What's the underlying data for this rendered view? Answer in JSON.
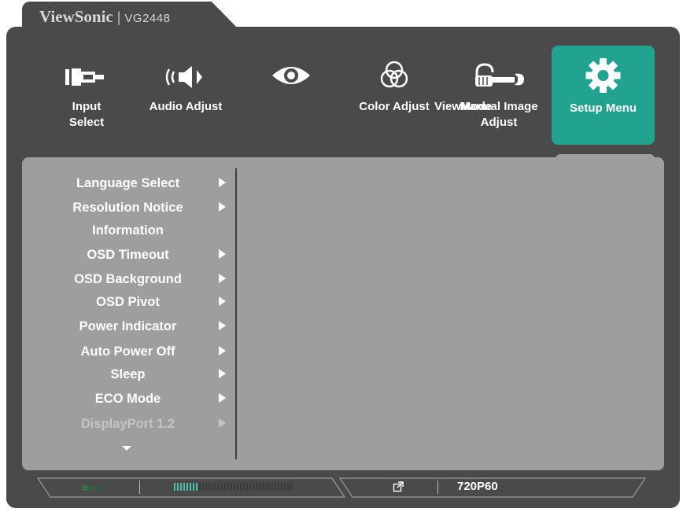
{
  "brand": {
    "logo": "ViewSonic",
    "separator": "|",
    "model": "VG2448"
  },
  "top_menu": [
    {
      "label": "Input\nSelect",
      "icon": "input-select-icon"
    },
    {
      "label": "Audio Adjust",
      "icon": "speaker-icon"
    },
    {
      "label": "",
      "icon": "eye-icon"
    },
    {
      "label": "Color Adjust",
      "icon": "color-circles-icon"
    },
    {
      "label": "ViewMode",
      "icon": "hand-wrench-icon"
    },
    {
      "label": "Manual Image\nAdjust",
      "icon": "hand-wrench-icon"
    },
    {
      "label": "Setup Menu",
      "icon": "gear-icon",
      "selected": true
    }
  ],
  "submenu": [
    {
      "label": "Language Select",
      "arrow": true
    },
    {
      "label": "Resolution Notice",
      "arrow": true
    },
    {
      "label": "Information",
      "arrow": false
    },
    {
      "label": "OSD Timeout",
      "arrow": true
    },
    {
      "label": "OSD Background",
      "arrow": true
    },
    {
      "label": "OSD Pivot",
      "arrow": true
    },
    {
      "label": "Power Indicator",
      "arrow": true
    },
    {
      "label": "Auto Power Off",
      "arrow": true
    },
    {
      "label": "Sleep",
      "arrow": true
    },
    {
      "label": "ECO Mode",
      "arrow": true
    },
    {
      "label": "DisplayPort 1.2",
      "arrow": true,
      "disabled": true
    }
  ],
  "status_bar": {
    "eco_label": "ECO",
    "eco_level_fraction": 0.2,
    "resolution": "720P60",
    "icon": "external-link-icon"
  },
  "colors": {
    "frame": "#4a4a4a",
    "panel": "#9e9e9e",
    "accent": "#21a390",
    "eco_bar": "#4bbfad",
    "text": "#ffffff",
    "disabled_text": "#c4c4c4"
  }
}
